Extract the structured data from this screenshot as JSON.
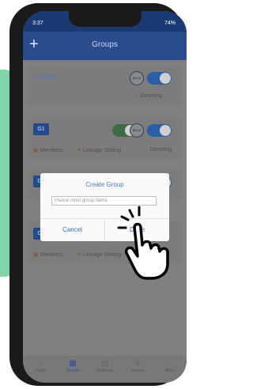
{
  "status_bar": {
    "time": "3:37",
    "battery": "74%"
  },
  "app_bar": {
    "title": "Groups",
    "add_icon": "+"
  },
  "all_lights": {
    "label": "All Lights",
    "dimming_label": "Dimming"
  },
  "groups": [
    {
      "badge": "G1",
      "members_label": "Members",
      "linkage_label": "Linkage Setting",
      "dimming_label": "Dimming"
    },
    {
      "badge": "G2"
    },
    {
      "badge": "G3",
      "members_label": "Members",
      "linkage_label": "Linkage Setting"
    }
  ],
  "bulb_icon_text": "BULB",
  "dialog": {
    "title": "Create Group",
    "input_placeholder": "Please input group name",
    "input_value": "",
    "cancel_label": "Cancel",
    "done_label": "Done"
  },
  "bottom_nav": [
    {
      "label": "Lights",
      "icon": "bulb-icon"
    },
    {
      "label": "Groups",
      "icon": "groups-icon",
      "active": true
    },
    {
      "label": "Switches",
      "icon": "switch-icon"
    },
    {
      "label": "Scenes",
      "icon": "scene-icon"
    },
    {
      "label": "More",
      "icon": "more-icon"
    }
  ],
  "colors": {
    "app_bar": "#2b4c8c",
    "accent": "#4a78c8",
    "toggle_on": "#2b5fa5",
    "side_card": "#7fd4a8"
  }
}
